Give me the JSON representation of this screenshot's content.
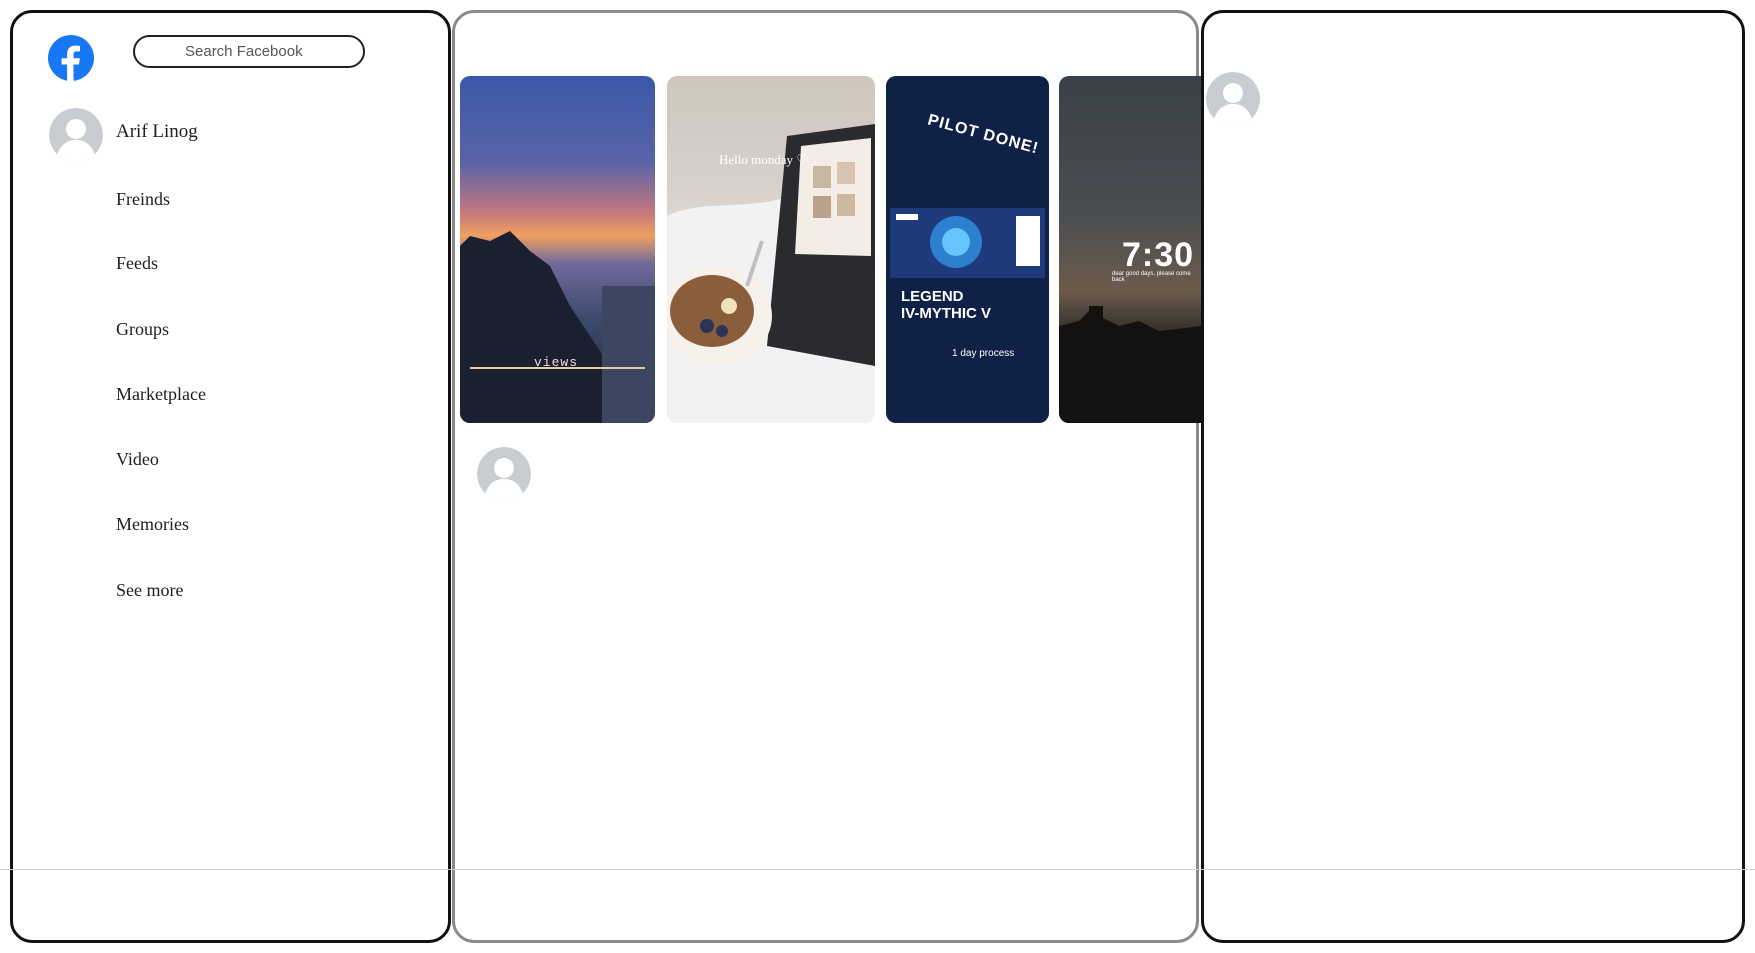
{
  "search": {
    "placeholder": "Search Facebook"
  },
  "user": {
    "name": "Arif Linog"
  },
  "nav": [
    {
      "label": "Freinds"
    },
    {
      "label": "Feeds"
    },
    {
      "label": "Groups"
    },
    {
      "label": "Marketplace"
    },
    {
      "label": "Video"
    },
    {
      "label": "Memories"
    },
    {
      "label": "See more"
    }
  ],
  "stories": [
    {
      "text1": "views",
      "text2": ""
    },
    {
      "caption": "Hello monday ♡"
    },
    {
      "title": "PILOT DONE!",
      "rank": "LEGEND\nIV-MYTHIC V",
      "sub": "1 day process"
    },
    {
      "time": "7:30",
      "note": "dear good days, please come back"
    }
  ],
  "icons": {
    "logo": "facebook-logo-icon",
    "avatar": "default-avatar-icon"
  },
  "colors": {
    "brand": "#1877f2",
    "avatar_bg": "#c9ccd1"
  }
}
